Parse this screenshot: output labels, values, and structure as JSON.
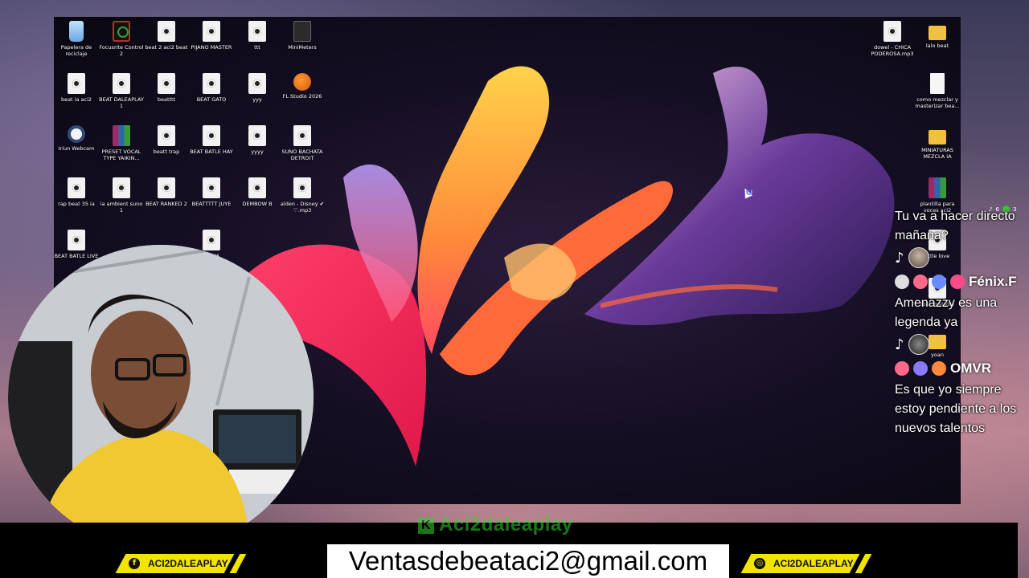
{
  "desktop": {
    "icons_left": [
      {
        "label": "Papelera de reciclaje",
        "type": "bin"
      },
      {
        "label": "Focusrite Control 2",
        "type": "focus"
      },
      {
        "label": "beat 2 aci2 beat",
        "type": "file"
      },
      {
        "label": "PIJANO MASTER",
        "type": "file"
      },
      {
        "label": "ttt",
        "type": "file"
      },
      {
        "label": "MiniMeters",
        "type": "meter"
      },
      {
        "label": "beat ia aci2",
        "type": "file"
      },
      {
        "label": "BEAT DALEAPLAY 1",
        "type": "file"
      },
      {
        "label": "beatttt",
        "type": "file"
      },
      {
        "label": "BEAT GATO",
        "type": "file"
      },
      {
        "label": "yyy",
        "type": "file"
      },
      {
        "label": "FL Studio 2026",
        "type": "fl"
      },
      {
        "label": "Iriun Webcam",
        "type": "cam"
      },
      {
        "label": "PRESET VOCAL TYPE YAIKIN...",
        "type": "rar"
      },
      {
        "label": "beatt trap",
        "type": "file"
      },
      {
        "label": "BEAT BATLE HAY",
        "type": "file"
      },
      {
        "label": "yyyy",
        "type": "file"
      },
      {
        "label": "SUNO BACHATA DETROIT",
        "type": "file"
      },
      {
        "label": "rap beat 35 ia",
        "type": "file"
      },
      {
        "label": "ia ambient suno 1",
        "type": "file"
      },
      {
        "label": "BEAT RANKED 2",
        "type": "file"
      },
      {
        "label": "BEATTTTT JUYE",
        "type": "file"
      },
      {
        "label": "DEMBOW B",
        "type": "file"
      },
      {
        "label": "alden - Disney ✔ ♡.mp3",
        "type": "file"
      },
      {
        "label": "BEAT BATLE LIVE",
        "type": "file"
      },
      {
        "label": "LEYVA",
        "type": "file"
      }
    ],
    "icons_right": [
      {
        "label": "dowel - CHICA PODEROSA.mp3",
        "type": "file"
      },
      {
        "label": "lalo beat",
        "type": "folder"
      },
      {
        "label": "como mezclar y masterizar bea...",
        "type": "doc"
      },
      {
        "label": "MINIATURAS MEZCLA IA",
        "type": "folder"
      },
      {
        "label": "plantilla para voces aci2",
        "type": "rar"
      },
      {
        "label": "little love",
        "type": "file"
      },
      {
        "label": "rock melodia",
        "type": "file"
      },
      {
        "label": "yoan",
        "type": "folder"
      }
    ]
  },
  "overlay_counts": {
    "viewers_tiktok": "6",
    "viewers_kick": "3"
  },
  "chat": {
    "msg1": "Tu va a hacer directo mañana?",
    "user2": "Fénix.F",
    "msg2": "Amenazzy es una legenda ya",
    "user3": "OMVR",
    "msg3": "Es que yo siempre estoy pendiente a los nuevos talentos"
  },
  "footer": {
    "kick_channel": "Aci2daleaplay",
    "email": "Ventasdebeataci2@gmail.com",
    "facebook_handle": "ACI2DALEAPLAY",
    "instagram_handle": "ACI2DALEAPLAY"
  },
  "colors": {
    "accent_yellow": "#f2e400",
    "kick_green": "#2fd82f"
  }
}
